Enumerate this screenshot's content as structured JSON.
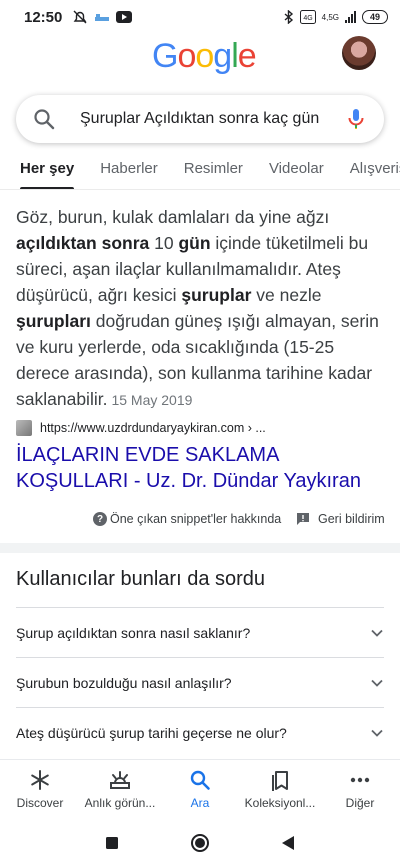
{
  "status_bar": {
    "time": "12:50",
    "network": "4,5G",
    "battery": "49"
  },
  "logo": [
    "G",
    "o",
    "o",
    "g",
    "l",
    "e"
  ],
  "search": {
    "query": "Şuruplar Açıldıktan sonra kaç gün"
  },
  "tabs": [
    "Her şey",
    "Haberler",
    "Resimler",
    "Videolar",
    "Alışveriş"
  ],
  "snippet": {
    "segments": [
      {
        "t": "Göz, burun, kulak damlaları da yine ağzı ",
        "b": false
      },
      {
        "t": "açıldıktan sonra",
        "b": true
      },
      {
        "t": " 10 ",
        "b": false
      },
      {
        "t": "gün",
        "b": true
      },
      {
        "t": " içinde tüketilmeli bu süreci, aşan ilaçlar kullanılmamalıdır. Ateş düşürücü, ağrı kesici ",
        "b": false
      },
      {
        "t": "şuruplar",
        "b": true
      },
      {
        "t": " ve nezle ",
        "b": false
      },
      {
        "t": "şurupları",
        "b": true
      },
      {
        "t": " doğrudan güneş ışığı almayan, serin ve kuru yerlerde, oda sıcaklığında (15-25 derece arasında), son kullanma tarihine kadar saklanabilir.",
        "b": false
      }
    ],
    "date": "15 May 2019"
  },
  "source": {
    "url": "https://www.uzdrdundaryaykiran.com › ..."
  },
  "result_title": "İLAÇLARIN EVDE SAKLAMA KOŞULLARI - Uz. Dr. Dündar Yaykıran",
  "feedback": {
    "about": "Öne çıkan snippet'ler hakkında",
    "send": "Geri bildirim"
  },
  "paa": {
    "title": "Kullanıcılar bunları da sordu",
    "questions": [
      "Şurup açıldıktan sonra nasıl saklanır?",
      "Şurubun bozulduğu nasıl anlaşılır?",
      "Ateş düşürücü şurup tarihi geçerse ne olur?"
    ]
  },
  "bottom_nav": [
    {
      "label": "Discover",
      "icon": "asterisk-icon"
    },
    {
      "label": "Anlık görün...",
      "icon": "snapshot-icon"
    },
    {
      "label": "Ara",
      "icon": "search-icon"
    },
    {
      "label": "Koleksiyonl...",
      "icon": "collections-icon"
    },
    {
      "label": "Diğer",
      "icon": "more-icon"
    }
  ],
  "colors": {
    "link": "#1a0dab",
    "active": "#1a73e8"
  }
}
